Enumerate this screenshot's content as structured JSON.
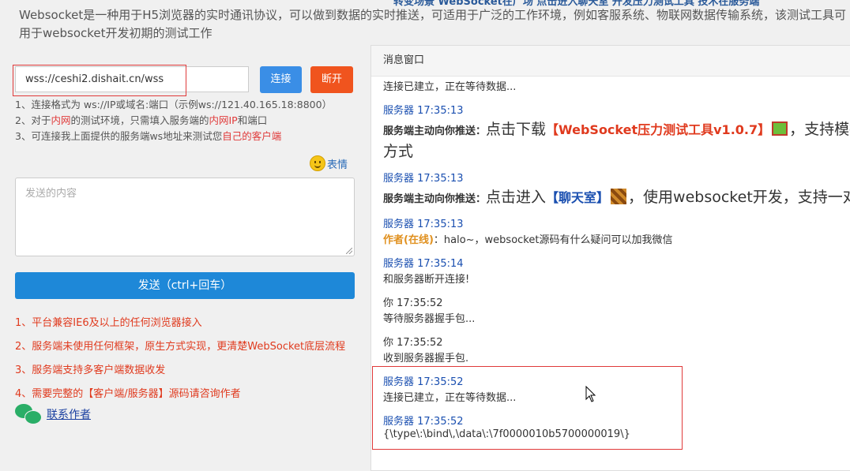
{
  "top_clipped_text": "转变场景    WebSocket在广场   点击进入聊天室   开发压力测试工具   技术在服务端",
  "intro": "Websocket是一种用于H5浏览器的实时通讯协议，可以做到数据的实时推送，可适用于广泛的工作环境，例如客服系统、物联网数据传输系统，该测试工具可用于websocket开发初期的测试工作",
  "connection": {
    "url_value": "wss://ceshi2.dishait.cn/wss",
    "connect_label": "连接",
    "disconnect_label": "断开"
  },
  "notes": {
    "line1": "1、连接格式为 ws://IP或域名:端口（示例ws://121.40.165.18:8800）",
    "line2_a": "2、对于",
    "line2_b": "内网",
    "line2_c": "的测试环境，只需填入服务端的",
    "line2_d": "内网IP",
    "line2_e": "和端口",
    "line3_a": "3、可连接我上面提供的服务端ws地址来测试您",
    "line3_b": "自己的客户端"
  },
  "emoji_label": "表情",
  "send_placeholder": "发送的内容",
  "send_label": "发送（ctrl+回车）",
  "features": [
    "1、平台兼容IE6及以上的任何浏览器接入",
    "2、服务端未使用任何框架，原生方式实现，更清楚WebSocket底层流程",
    "3、服务端支持多客户端数据收发",
    "4、需要完整的【客户端/服务器】源码请咨询作者"
  ],
  "contact_label": "联系作者",
  "message_window": {
    "title": "消息窗口",
    "line0": "连接已建立，正在等待数据...",
    "m1_sender": "服务器 17:35:13",
    "m1_prefix": "服务端主动向你推送：",
    "m1_text_a": "点击下载",
    "m1_brand": "【WebSocket压力测试工具v1.0.7】",
    "m1_text_b": "，支持模拟多",
    "m1_text_c": "方式",
    "m2_sender": "服务器 17:35:13",
    "m2_prefix": "服务端主动向你推送：",
    "m2_text_a": "点击进入",
    "m2_link": "【聊天室】",
    "m2_text_b": "，使用websocket开发，支持一对",
    "m3_sender": "服务器 17:35:13",
    "m3_author": "作者(在线)",
    "m3_text": "：halo~，websocket源码有什么疑问可以加我微信",
    "m4_sender": "服务器 17:35:14",
    "m4_text": "和服务器断开连接!",
    "m5_sender": "你 17:35:52",
    "m5_text": "等待服务器握手包...",
    "m6_sender": "你 17:35:52",
    "m6_text": "收到服务器握手包.",
    "m7_sender": "服务器 17:35:52",
    "m7_text": "连接已建立，正在等待数据...",
    "m8_sender": "服务器 17:35:52",
    "m8_text": "{\\type\\:\\bind\\,\\data\\:\\7f0000010b5700000019\\}"
  }
}
